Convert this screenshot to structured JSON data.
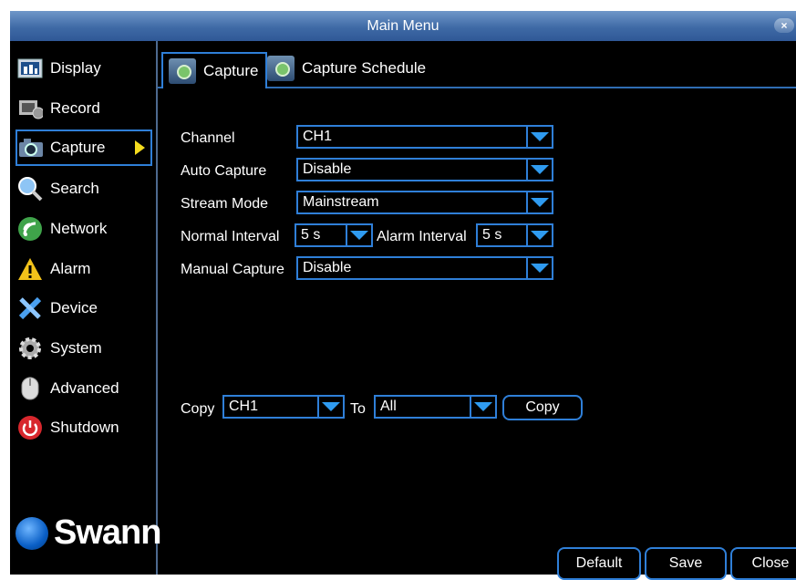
{
  "window": {
    "title": "Main Menu",
    "close_label": "×"
  },
  "sidebar": {
    "items": [
      {
        "label": "Display",
        "icon": "display-icon"
      },
      {
        "label": "Record",
        "icon": "record-icon"
      },
      {
        "label": "Capture",
        "icon": "camera-icon",
        "active": true
      },
      {
        "label": "Search",
        "icon": "search-icon"
      },
      {
        "label": "Network",
        "icon": "network-icon"
      },
      {
        "label": "Alarm",
        "icon": "alarm-icon"
      },
      {
        "label": "Device",
        "icon": "device-icon"
      },
      {
        "label": "System",
        "icon": "gear-icon"
      },
      {
        "label": "Advanced",
        "icon": "mouse-icon"
      },
      {
        "label": "Shutdown",
        "icon": "power-icon"
      }
    ],
    "logo_text": "Swann"
  },
  "tabs": [
    {
      "label": "Capture",
      "active": true
    },
    {
      "label": "Capture Schedule",
      "active": false
    }
  ],
  "form": {
    "channel_label": "Channel",
    "channel_value": "CH1",
    "auto_capture_label": "Auto Capture",
    "auto_capture_value": "Disable",
    "stream_mode_label": "Stream Mode",
    "stream_mode_value": "Mainstream",
    "normal_interval_label": "Normal Interval",
    "normal_interval_value": "5 s",
    "alarm_interval_label": "Alarm Interval",
    "alarm_interval_value": "5 s",
    "manual_capture_label": "Manual Capture",
    "manual_capture_value": "Disable"
  },
  "copy": {
    "copy_label": "Copy",
    "from_value": "CH1",
    "to_label": "To",
    "to_value": "All",
    "button_label": "Copy"
  },
  "footer": {
    "default_label": "Default",
    "save_label": "Save",
    "close_label": "Close"
  },
  "colors": {
    "accent": "#2f7fd8",
    "titlebar": "#3f6aa6",
    "arrow": "#f5dc1e",
    "background": "#000000"
  }
}
